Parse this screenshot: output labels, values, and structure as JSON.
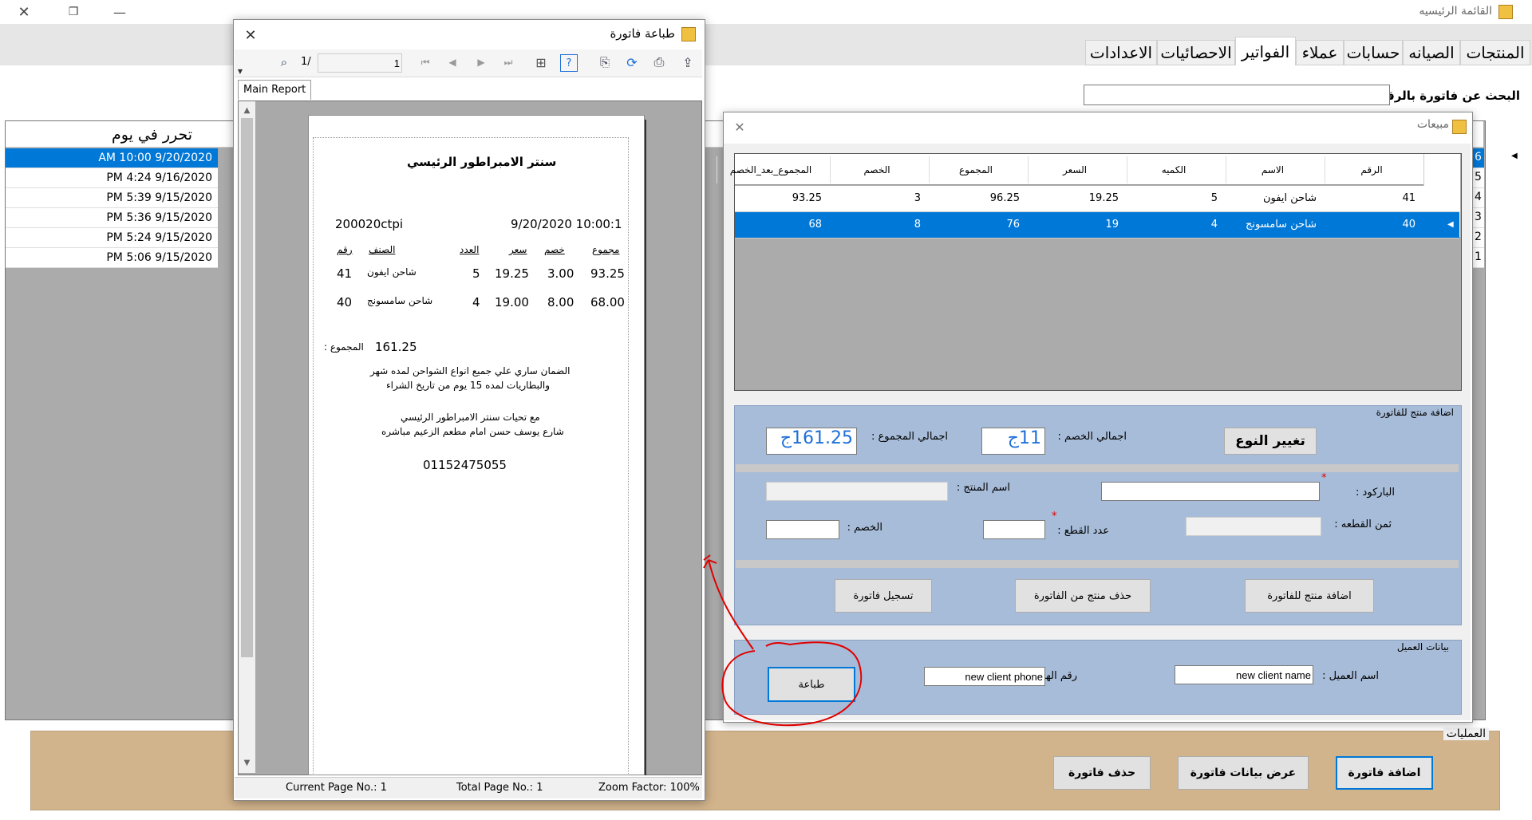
{
  "main_window": {
    "title": "القائمة الرئيسيه"
  },
  "tabs": [
    {
      "label": "المنتجات"
    },
    {
      "label": "الصيانه"
    },
    {
      "label": "حسابات"
    },
    {
      "label": "عملاء"
    },
    {
      "label": "الفواتير"
    },
    {
      "label": "الاحصائيات"
    },
    {
      "label": "الاعدادات"
    }
  ],
  "search": {
    "label": "البحث عن فاتورة بالرقم :",
    "value": ""
  },
  "invoice_grid": {
    "date_header": "تحرر في يوم",
    "rows": [
      {
        "date": "AM 10:00 9/20/2020",
        "num": "6"
      },
      {
        "date": "PM 4:24 9/16/2020",
        "num": "5"
      },
      {
        "date": "PM 5:39 9/15/2020",
        "num": "4"
      },
      {
        "date": "PM 5:36 9/15/2020",
        "num": "3"
      },
      {
        "date": "PM 5:24 9/15/2020",
        "num": "2"
      },
      {
        "date": "PM 5:06 9/15/2020",
        "num": "1"
      }
    ]
  },
  "operations": {
    "title": "العمليات",
    "add_invoice": "اضافة فاتورة",
    "show_invoice": "عرض بيانات فاتورة",
    "delete_invoice": "حذف فاتورة"
  },
  "print_window": {
    "title": "طباعة فاتورة",
    "page_input": "1",
    "page_total": "1/",
    "tab_label": "Main Report",
    "status": {
      "current_page": "Current Page No.: 1",
      "total_page": "Total Page No.: 1",
      "zoom": "Zoom Factor: 100%"
    },
    "report": {
      "shop_name": "سنتر الامبراطور الرئيسي",
      "invoice_code": "200020ctpi",
      "datetime": "9/20/2020 10:00:1",
      "headers": [
        "مجموع",
        "خصم",
        "سعر",
        "العدد",
        "الصنف",
        "رقم"
      ],
      "items": [
        {
          "total": "93.25",
          "discount": "3.00",
          "price": "19.25",
          "qty": "5",
          "name": "شاحن ايفون",
          "num": "41"
        },
        {
          "total": "68.00",
          "discount": "8.00",
          "price": "19.00",
          "qty": "4",
          "name": "شاحن سامسونج",
          "num": "40"
        }
      ],
      "grand_total": "161.25",
      "grand_total_label": "المجموع :",
      "warranty_line1": "الضمان ساري علي جميع انواع الشواحن لمده شهر",
      "warranty_line2": "والبطاريات لمده 15 يوم من تاريخ الشراء",
      "greet_line1": "مع تحيات سنتر الامبراطور الرئيسي",
      "greet_line2": "شارع يوسف حسن امام مطعم الزعيم مباشره",
      "phone": "01152475055"
    }
  },
  "sales_window": {
    "title": "مبيعات",
    "columns": [
      "الرقم",
      "الاسم",
      "الكميه",
      "السعر",
      "المجموع",
      "الخصم",
      "المجموع_بعد_الخصم"
    ],
    "rows": [
      {
        "num": "41",
        "name": "شاحن ايفون",
        "qty": "5",
        "price": "19.25",
        "total": "96.25",
        "discount": "3",
        "net": "93.25"
      },
      {
        "num": "40",
        "name": "شاحن سامسونج",
        "qty": "4",
        "price": "19",
        "total": "76",
        "discount": "8",
        "net": "68"
      }
    ],
    "add_group": {
      "title": "اضافة منتج للفاتورة",
      "change_type": "تغيير النوع",
      "total_discount_label": "اجمالي الخصم :",
      "total_discount_value": "11ج",
      "grand_total_label": "اجمالي المجموع :",
      "grand_total_value": "161.25ج",
      "barcode_label": "الباركود :",
      "product_name_label": "اسم المنتج :",
      "unit_price_label": "ثمن القطعه :",
      "qty_label": "عدد القطع :",
      "discount_label": "الخصم :",
      "required_mark": "*",
      "add_product": "اضافة منتج للفاتورة",
      "delete_product": "حذف منتج من الفاتورة",
      "save_invoice": "تسجيل فاتورة"
    },
    "client_group": {
      "title": "بيانات العميل",
      "name_label": "اسم العميل :",
      "name_value": "new client name",
      "phone_label": "رقم الهاتف :",
      "phone_value": "new client phone",
      "print": "طباعة"
    }
  },
  "colors": {
    "selection": "#0078d7",
    "group_bg": "#a7bcd8",
    "ops_bg": "#d2b48c",
    "annotation": "#e00000"
  }
}
